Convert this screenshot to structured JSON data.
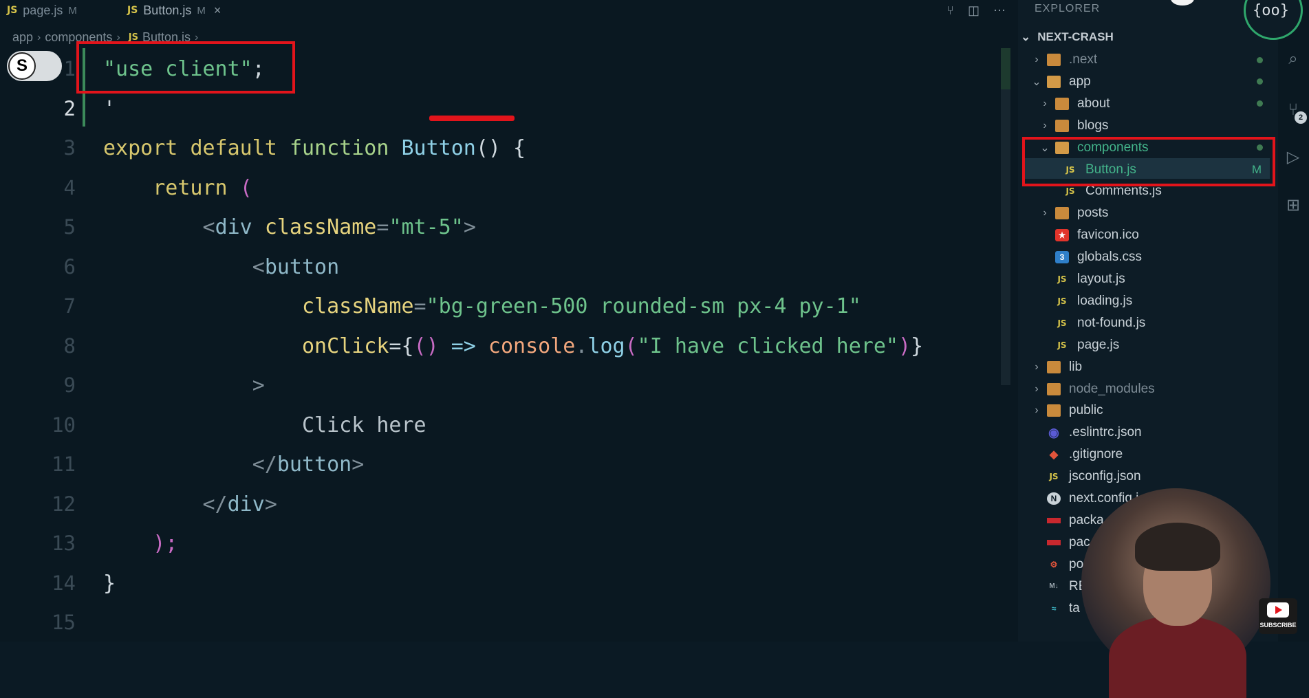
{
  "tabs": [
    {
      "label": "page.js",
      "modified": "M",
      "active": false
    },
    {
      "label": "Button.js",
      "modified": "M",
      "active": true
    }
  ],
  "breadcrumb": [
    "app",
    "components",
    "Button.js"
  ],
  "editor": {
    "line_numbers": [
      "1",
      "2",
      "3",
      "4",
      "5",
      "6",
      "7",
      "8",
      "9",
      "10",
      "11",
      "12",
      "13",
      "14",
      "15"
    ],
    "active_line": "2",
    "text_cursor": "'",
    "lines": [
      {
        "n": 1,
        "parts": [
          {
            "t": "\"use client\"",
            "c": "str"
          },
          {
            "t": ";",
            "c": "pn"
          }
        ]
      },
      {
        "n": 2,
        "parts": [
          {
            "t": "'",
            "c": "pn"
          }
        ]
      },
      {
        "n": 3,
        "parts": [
          {
            "t": "export ",
            "c": "k"
          },
          {
            "t": "default ",
            "c": "k"
          },
          {
            "t": "function ",
            "c": "kw2"
          },
          {
            "t": "Button",
            "c": "fn"
          },
          {
            "t": "() {",
            "c": "pn"
          }
        ]
      },
      {
        "n": 4,
        "parts": [
          {
            "t": "    return ",
            "c": "k"
          },
          {
            "t": "(",
            "c": "par"
          }
        ]
      },
      {
        "n": 5,
        "parts": [
          {
            "t": "        ",
            "c": "pn"
          },
          {
            "t": "<",
            "c": "ang"
          },
          {
            "t": "div ",
            "c": "tag"
          },
          {
            "t": "className",
            "c": "attr"
          },
          {
            "t": "=",
            "c": "ang"
          },
          {
            "t": "\"mt-5\"",
            "c": "str"
          },
          {
            "t": ">",
            "c": "ang"
          }
        ]
      },
      {
        "n": 6,
        "parts": [
          {
            "t": "            ",
            "c": "pn"
          },
          {
            "t": "<",
            "c": "ang"
          },
          {
            "t": "button",
            "c": "tag"
          }
        ]
      },
      {
        "n": 7,
        "parts": [
          {
            "t": "                ",
            "c": "pn"
          },
          {
            "t": "className",
            "c": "attr"
          },
          {
            "t": "=",
            "c": "ang"
          },
          {
            "t": "\"bg-green-500 rounded-sm px-4 py-1\"",
            "c": "str"
          }
        ]
      },
      {
        "n": 8,
        "parts": [
          {
            "t": "                ",
            "c": "pn"
          },
          {
            "t": "onClick",
            "c": "attr"
          },
          {
            "t": "={",
            "c": "pn"
          },
          {
            "t": "()",
            "c": "par"
          },
          {
            "t": " => ",
            "c": "op"
          },
          {
            "t": "console",
            "c": "obj"
          },
          {
            "t": ".",
            "c": "ang"
          },
          {
            "t": "log",
            "c": "fn"
          },
          {
            "t": "(",
            "c": "par"
          },
          {
            "t": "\"I have clicked here\"",
            "c": "str"
          },
          {
            "t": ")",
            "c": "par"
          },
          {
            "t": "}",
            "c": "pn"
          }
        ]
      },
      {
        "n": 9,
        "parts": [
          {
            "t": "            ",
            "c": "pn"
          },
          {
            "t": ">",
            "c": "ang"
          }
        ]
      },
      {
        "n": 10,
        "parts": [
          {
            "t": "                Click here",
            "c": "txt"
          }
        ]
      },
      {
        "n": 11,
        "parts": [
          {
            "t": "            ",
            "c": "pn"
          },
          {
            "t": "</",
            "c": "ang"
          },
          {
            "t": "button",
            "c": "tag"
          },
          {
            "t": ">",
            "c": "ang"
          }
        ]
      },
      {
        "n": 12,
        "parts": [
          {
            "t": "        ",
            "c": "pn"
          },
          {
            "t": "</",
            "c": "ang"
          },
          {
            "t": "div",
            "c": "tag"
          },
          {
            "t": ">",
            "c": "ang"
          }
        ]
      },
      {
        "n": 13,
        "parts": [
          {
            "t": "    ",
            "c": "pn"
          },
          {
            "t": ");",
            "c": "par"
          }
        ]
      },
      {
        "n": 14,
        "parts": [
          {
            "t": "}",
            "c": "pn"
          }
        ]
      },
      {
        "n": 15,
        "parts": []
      }
    ]
  },
  "avatar_pill": {
    "letter": "S"
  },
  "explorer": {
    "title": "EXPLORER",
    "project": "NEXT-CRASH",
    "items": [
      {
        "label": ".next",
        "kind": "folder",
        "chev": "›",
        "indent": 0,
        "dot": true,
        "dim": true
      },
      {
        "label": "app",
        "kind": "folder-open",
        "chev": "⌄",
        "indent": 0,
        "dot": true
      },
      {
        "label": "about",
        "kind": "folder",
        "chev": "›",
        "indent": 1,
        "dot": true
      },
      {
        "label": "blogs",
        "kind": "folder",
        "chev": "›",
        "indent": 1
      },
      {
        "label": "components",
        "kind": "folder-open",
        "chev": "⌄",
        "indent": 1,
        "dot": true,
        "accent": true
      },
      {
        "label": "Button.js",
        "kind": "js",
        "chev": "",
        "indent": 2,
        "flag": "M",
        "selected": true,
        "accent": true
      },
      {
        "label": "Comments.js",
        "kind": "js",
        "chev": "",
        "indent": 2
      },
      {
        "label": "posts",
        "kind": "folder",
        "chev": "›",
        "indent": 1
      },
      {
        "label": "favicon.ico",
        "kind": "star",
        "chev": "",
        "indent": 1
      },
      {
        "label": "globals.css",
        "kind": "css",
        "chev": "",
        "indent": 1
      },
      {
        "label": "layout.js",
        "kind": "js",
        "chev": "",
        "indent": 1
      },
      {
        "label": "loading.js",
        "kind": "js",
        "chev": "",
        "indent": 1
      },
      {
        "label": "not-found.js",
        "kind": "js",
        "chev": "",
        "indent": 1
      },
      {
        "label": "page.js",
        "kind": "js",
        "chev": "",
        "indent": 1
      },
      {
        "label": "lib",
        "kind": "folder",
        "chev": "›",
        "indent": 0
      },
      {
        "label": "node_modules",
        "kind": "folder",
        "chev": "›",
        "indent": 0,
        "dim": true
      },
      {
        "label": "public",
        "kind": "folder",
        "chev": "›",
        "indent": 0
      },
      {
        "label": ".eslintrc.json",
        "kind": "eslint",
        "chev": "",
        "indent": 0
      },
      {
        "label": ".gitignore",
        "kind": "git",
        "chev": "",
        "indent": 0
      },
      {
        "label": "jsconfig.json",
        "kind": "js",
        "chev": "",
        "indent": 0
      },
      {
        "label": "next.config.j",
        "kind": "next",
        "chev": "",
        "indent": 0
      },
      {
        "label": "packa",
        "kind": "npm",
        "chev": "",
        "indent": 0
      },
      {
        "label": "pac",
        "kind": "npm",
        "chev": "",
        "indent": 0
      },
      {
        "label": "po",
        "kind": "gear",
        "chev": "",
        "indent": 0
      },
      {
        "label": "RE",
        "kind": "md",
        "chev": "",
        "indent": 0
      },
      {
        "label": "ta",
        "kind": "wave",
        "chev": "",
        "indent": 0
      }
    ]
  },
  "activity": {
    "scm_badge": "2"
  },
  "youtube": {
    "label": "SUBSCRIBE"
  },
  "colors": {
    "highlight": "#e2141b",
    "accent": "#43b48a"
  }
}
